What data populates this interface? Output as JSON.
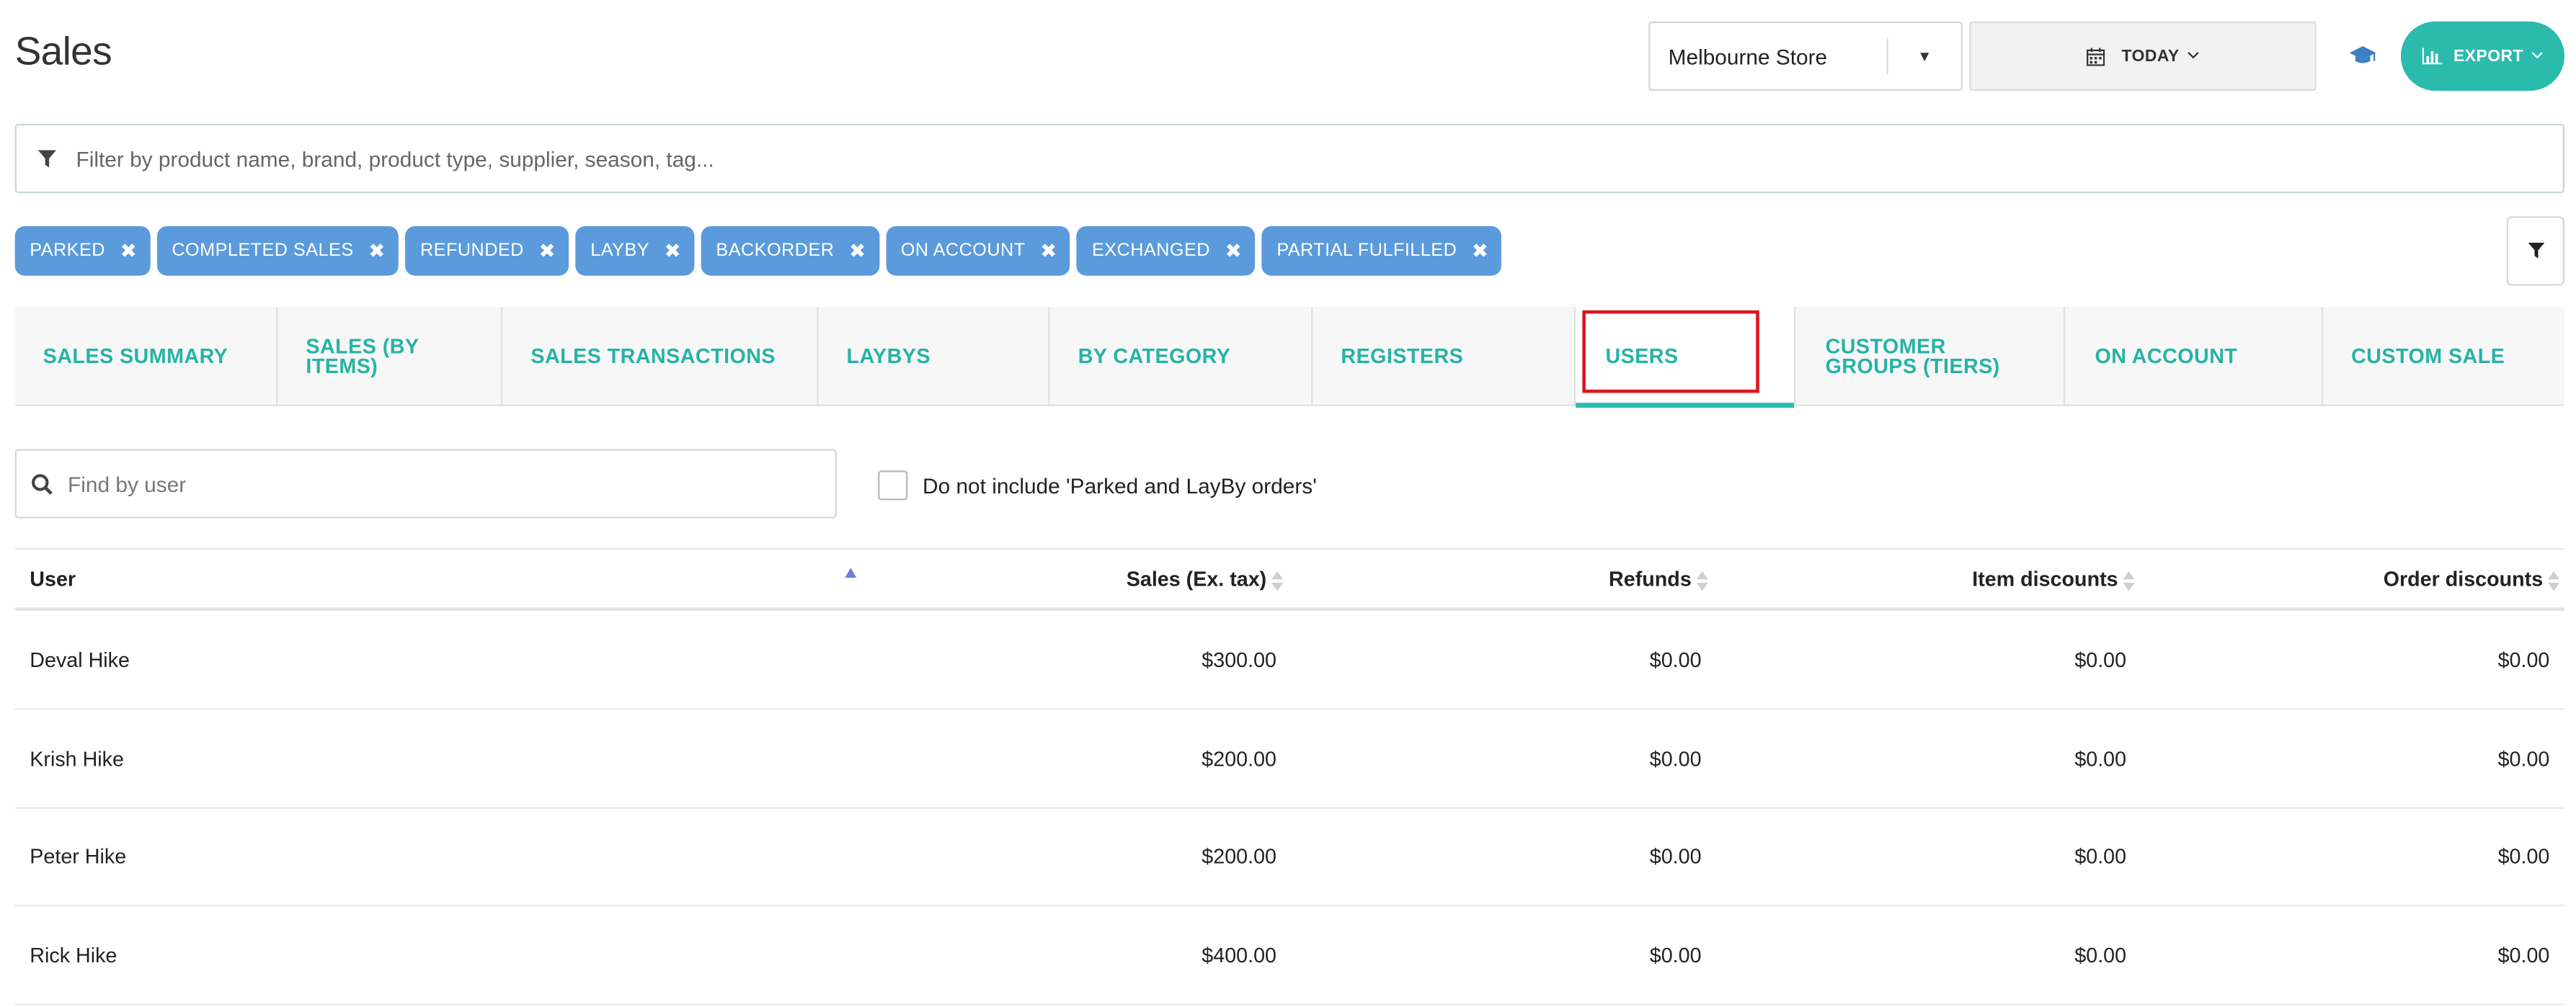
{
  "header": {
    "title": "Sales",
    "store_select": {
      "value": "Melbourne Store"
    },
    "date_button": {
      "label": "TODAY"
    },
    "export_button": {
      "label": "EXPORT"
    }
  },
  "filter": {
    "placeholder": "Filter by product name, brand, product type, supplier, season, tag..."
  },
  "chips": [
    "PARKED",
    "COMPLETED SALES",
    "REFUNDED",
    "LAYBY",
    "BACKORDER",
    "ON ACCOUNT",
    "EXCHANGED",
    "PARTIAL FULFILLED"
  ],
  "tabs": [
    {
      "label": "SALES SUMMARY"
    },
    {
      "label": "SALES (BY ITEMS)"
    },
    {
      "label": "SALES TRANSACTIONS"
    },
    {
      "label": "LAYBYS"
    },
    {
      "label": "BY CATEGORY"
    },
    {
      "label": "REGISTERS"
    },
    {
      "label": "USERS",
      "active": true
    },
    {
      "label": "CUSTOMER GROUPS (TIERS)"
    },
    {
      "label": "ON ACCOUNT"
    },
    {
      "label": "CUSTOM SALE"
    }
  ],
  "user_search": {
    "placeholder": "Find by user"
  },
  "exclude_checkbox": {
    "label": "Do not include 'Parked and LayBy orders'",
    "checked": false
  },
  "table": {
    "columns": [
      "User",
      "Sales (Ex. tax)",
      "Refunds",
      "Item discounts",
      "Order discounts"
    ],
    "rows": [
      [
        "Deval Hike",
        "$300.00",
        "$0.00",
        "$0.00",
        "$0.00"
      ],
      [
        "Krish Hike",
        "$200.00",
        "$0.00",
        "$0.00",
        "$0.00"
      ],
      [
        "Peter Hike",
        "$200.00",
        "$0.00",
        "$0.00",
        "$0.00"
      ],
      [
        "Rick Hike",
        "$400.00",
        "$0.00",
        "$0.00",
        "$0.00"
      ]
    ]
  },
  "colors": {
    "accent": "#2bbbad",
    "tab_text": "#26b3a5",
    "chip": "#5b9bdc",
    "highlight": "#e0141e"
  }
}
